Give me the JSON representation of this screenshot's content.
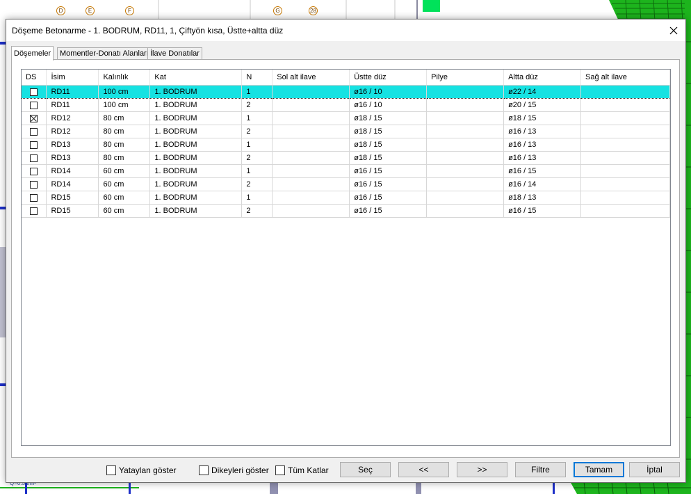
{
  "background": {
    "axis_labels": [
      "D",
      "E",
      "F",
      "G",
      "28"
    ],
    "load_label": "Q=0.5 t/m²"
  },
  "dialog": {
    "title": "Döşeme Betonarme - 1. BODRUM, RD11, 1, Çiftyön kısa, Üstte+altta düz",
    "close_glyph": "✕"
  },
  "tabs": [
    {
      "label": "Döşemeler",
      "active": true
    },
    {
      "label": "Momentler-Donatı Alanları",
      "active": false
    },
    {
      "label": "İlave Donatılar",
      "active": false
    }
  ],
  "table": {
    "columns": [
      "DS",
      "İsim",
      "Kalınlık",
      "Kat",
      "N",
      "Sol alt ilave",
      "Üstte düz",
      "Pilye",
      "Altta düz",
      "Sağ alt ilave"
    ],
    "rows": [
      {
        "ds": false,
        "isim": "RD11",
        "kalinlik": "100 cm",
        "kat": "1. BODRUM",
        "n": "1",
        "sol_alt_ilave": "",
        "ustte_duz": "ø16 / 10",
        "pilye": "",
        "altta_duz": "ø22 / 14",
        "sag_alt_ilave": "",
        "selected": true
      },
      {
        "ds": false,
        "isim": "RD11",
        "kalinlik": "100 cm",
        "kat": "1. BODRUM",
        "n": "2",
        "sol_alt_ilave": "",
        "ustte_duz": "ø16 / 10",
        "pilye": "",
        "altta_duz": "ø20 / 15",
        "sag_alt_ilave": "",
        "selected": false
      },
      {
        "ds": true,
        "isim": "RD12",
        "kalinlik": "80 cm",
        "kat": "1. BODRUM",
        "n": "1",
        "sol_alt_ilave": "",
        "ustte_duz": "ø18 / 15",
        "pilye": "",
        "altta_duz": "ø18 / 15",
        "sag_alt_ilave": "",
        "selected": false
      },
      {
        "ds": false,
        "isim": "RD12",
        "kalinlik": "80 cm",
        "kat": "1. BODRUM",
        "n": "2",
        "sol_alt_ilave": "",
        "ustte_duz": "ø18 / 15",
        "pilye": "",
        "altta_duz": "ø16 / 13",
        "sag_alt_ilave": "",
        "selected": false
      },
      {
        "ds": false,
        "isim": "RD13",
        "kalinlik": "80 cm",
        "kat": "1. BODRUM",
        "n": "1",
        "sol_alt_ilave": "",
        "ustte_duz": "ø18 / 15",
        "pilye": "",
        "altta_duz": "ø16 / 13",
        "sag_alt_ilave": "",
        "selected": false
      },
      {
        "ds": false,
        "isim": "RD13",
        "kalinlik": "80 cm",
        "kat": "1. BODRUM",
        "n": "2",
        "sol_alt_ilave": "",
        "ustte_duz": "ø18 / 15",
        "pilye": "",
        "altta_duz": "ø16 / 13",
        "sag_alt_ilave": "",
        "selected": false
      },
      {
        "ds": false,
        "isim": "RD14",
        "kalinlik": "60 cm",
        "kat": "1. BODRUM",
        "n": "1",
        "sol_alt_ilave": "",
        "ustte_duz": "ø16 / 15",
        "pilye": "",
        "altta_duz": "ø16 / 15",
        "sag_alt_ilave": "",
        "selected": false
      },
      {
        "ds": false,
        "isim": "RD14",
        "kalinlik": "60 cm",
        "kat": "1. BODRUM",
        "n": "2",
        "sol_alt_ilave": "",
        "ustte_duz": "ø16 / 15",
        "pilye": "",
        "altta_duz": "ø16 / 14",
        "sag_alt_ilave": "",
        "selected": false
      },
      {
        "ds": false,
        "isim": "RD15",
        "kalinlik": "60 cm",
        "kat": "1. BODRUM",
        "n": "1",
        "sol_alt_ilave": "",
        "ustte_duz": "ø16 / 15",
        "pilye": "",
        "altta_duz": "ø18 / 13",
        "sag_alt_ilave": "",
        "selected": false
      },
      {
        "ds": false,
        "isim": "RD15",
        "kalinlik": "60 cm",
        "kat": "1. BODRUM",
        "n": "2",
        "sol_alt_ilave": "",
        "ustte_duz": "ø16 / 15",
        "pilye": "",
        "altta_duz": "ø16 / 15",
        "sag_alt_ilave": "",
        "selected": false
      }
    ]
  },
  "footer": {
    "checkboxes": [
      {
        "label": "Yataylan göster",
        "checked": false
      },
      {
        "label": "Dikeyleri göster",
        "checked": false
      },
      {
        "label": "Tüm Katlar",
        "checked": false
      }
    ],
    "buttons": {
      "sec": "Seç",
      "prev": "<<",
      "next": ">>",
      "filtre": "Filtre",
      "tamam": "Tamam",
      "iptal": "İptal"
    }
  },
  "colors": {
    "selection": "#16e2e2",
    "cad_mesh": "#1db41d",
    "cad_blue": "#1d2fc8",
    "marker_green": "#00e25a"
  }
}
